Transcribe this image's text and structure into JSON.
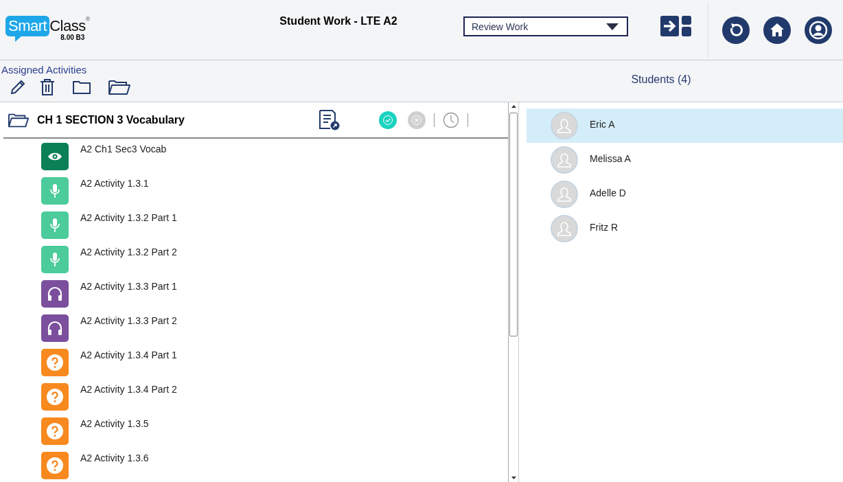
{
  "logo": {
    "word_1": "Smart",
    "word_2": "Class",
    "registered": "®",
    "version": "8.00 B3"
  },
  "header": {
    "title": "Student Work - LTE A2",
    "mode_select": {
      "value": "Review Work"
    }
  },
  "activities_toolbar": {
    "title": "Assigned Activities"
  },
  "folder": {
    "title": "CH 1 SECTION 3 Vocabulary",
    "activities": [
      {
        "kind": "view",
        "title": "A2 Ch1 Sec3 Vocab"
      },
      {
        "kind": "speak",
        "title": "A2 Activity 1.3.1"
      },
      {
        "kind": "speak",
        "title": "A2 Activity 1.3.2 Part 1"
      },
      {
        "kind": "speak",
        "title": "A2 Activity 1.3.2 Part 2"
      },
      {
        "kind": "listen",
        "title": "A2 Activity 1.3.3 Part 1"
      },
      {
        "kind": "listen",
        "title": "A2 Activity 1.3.3 Part 2"
      },
      {
        "kind": "quiz",
        "title": "A2 Activity 1.3.4 Part 1"
      },
      {
        "kind": "quiz",
        "title": "A2 Activity 1.3.4 Part 2"
      },
      {
        "kind": "quiz",
        "title": "A2 Activity 1.3.5"
      },
      {
        "kind": "quiz",
        "title": "A2 Activity 1.3.6"
      }
    ]
  },
  "students": {
    "title": "Students (4)",
    "items": [
      {
        "name": "Eric A",
        "selected": true
      },
      {
        "name": "Melissa A",
        "selected": false
      },
      {
        "name": "Adelle D",
        "selected": false
      },
      {
        "name": "Fritz R",
        "selected": false
      }
    ]
  }
}
